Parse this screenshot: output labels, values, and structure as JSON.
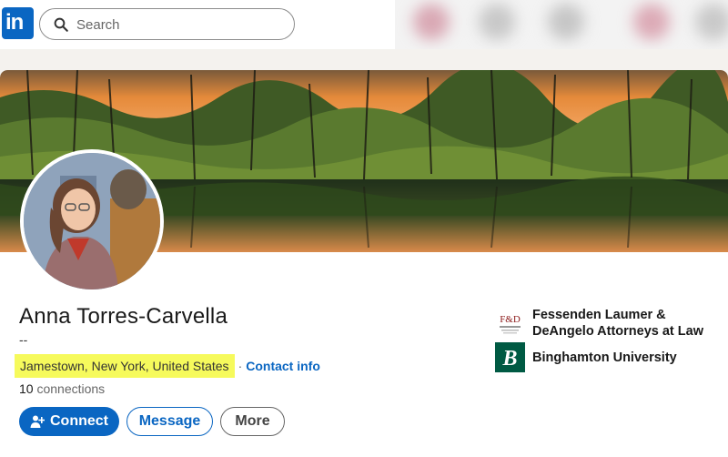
{
  "nav": {
    "logo": "in",
    "search_placeholder": "Search"
  },
  "profile": {
    "name": "Anna Torres-Carvella",
    "headline": "--",
    "location": "Jamestown, New York, United States",
    "separator": "·",
    "contact_info": "Contact info",
    "connections_count": "10",
    "connections_label": "connections"
  },
  "actions": {
    "connect": "Connect",
    "message": "Message",
    "more": "More"
  },
  "organizations": [
    {
      "name": "Fessenden Laumer & DeAngelo Attorneys at Law",
      "logo": "F&D"
    },
    {
      "name": "Binghamton University",
      "logo": "B"
    }
  ],
  "colors": {
    "accent": "#0a66c2",
    "highlight": "#f6fa5c"
  }
}
